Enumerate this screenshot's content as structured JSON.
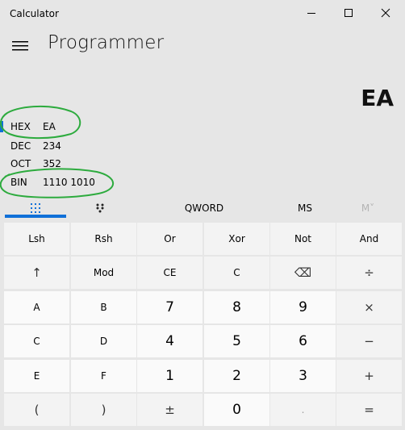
{
  "window": {
    "title": "Calculator"
  },
  "header": {
    "mode": "Programmer"
  },
  "display": {
    "value": "EA"
  },
  "radix": [
    {
      "name": "HEX",
      "value": "EA"
    },
    {
      "name": "DEC",
      "value": "234"
    },
    {
      "name": "OCT",
      "value": "352"
    },
    {
      "name": "BIN",
      "value": "1110 1010"
    }
  ],
  "toolbar": {
    "word_size": "QWORD",
    "ms": "MS",
    "mdrop": "M˅"
  },
  "keys": {
    "row1": [
      "Lsh",
      "Rsh",
      "Or",
      "Xor",
      "Not",
      "And"
    ],
    "row2": [
      "↑",
      "Mod",
      "CE",
      "C",
      "⌫",
      "÷"
    ],
    "row3": [
      "A",
      "B",
      "7",
      "8",
      "9",
      "×"
    ],
    "row4": [
      "C",
      "D",
      "4",
      "5",
      "6",
      "−"
    ],
    "row5": [
      "E",
      "F",
      "1",
      "2",
      "3",
      "+"
    ],
    "row6": [
      "(",
      ")",
      "±",
      "0",
      ".",
      "="
    ]
  },
  "colors": {
    "accent": "#1070d8",
    "annotation": "#2dab3e",
    "background": "#e6e6e6"
  },
  "icons": {
    "titlebar": [
      "minimize-icon",
      "maximize-icon",
      "close-icon"
    ],
    "menu": "hamburger-menu-icon",
    "keypad_tabs": [
      "full-keypad-icon",
      "bit-toggling-keypad-icon"
    ]
  }
}
